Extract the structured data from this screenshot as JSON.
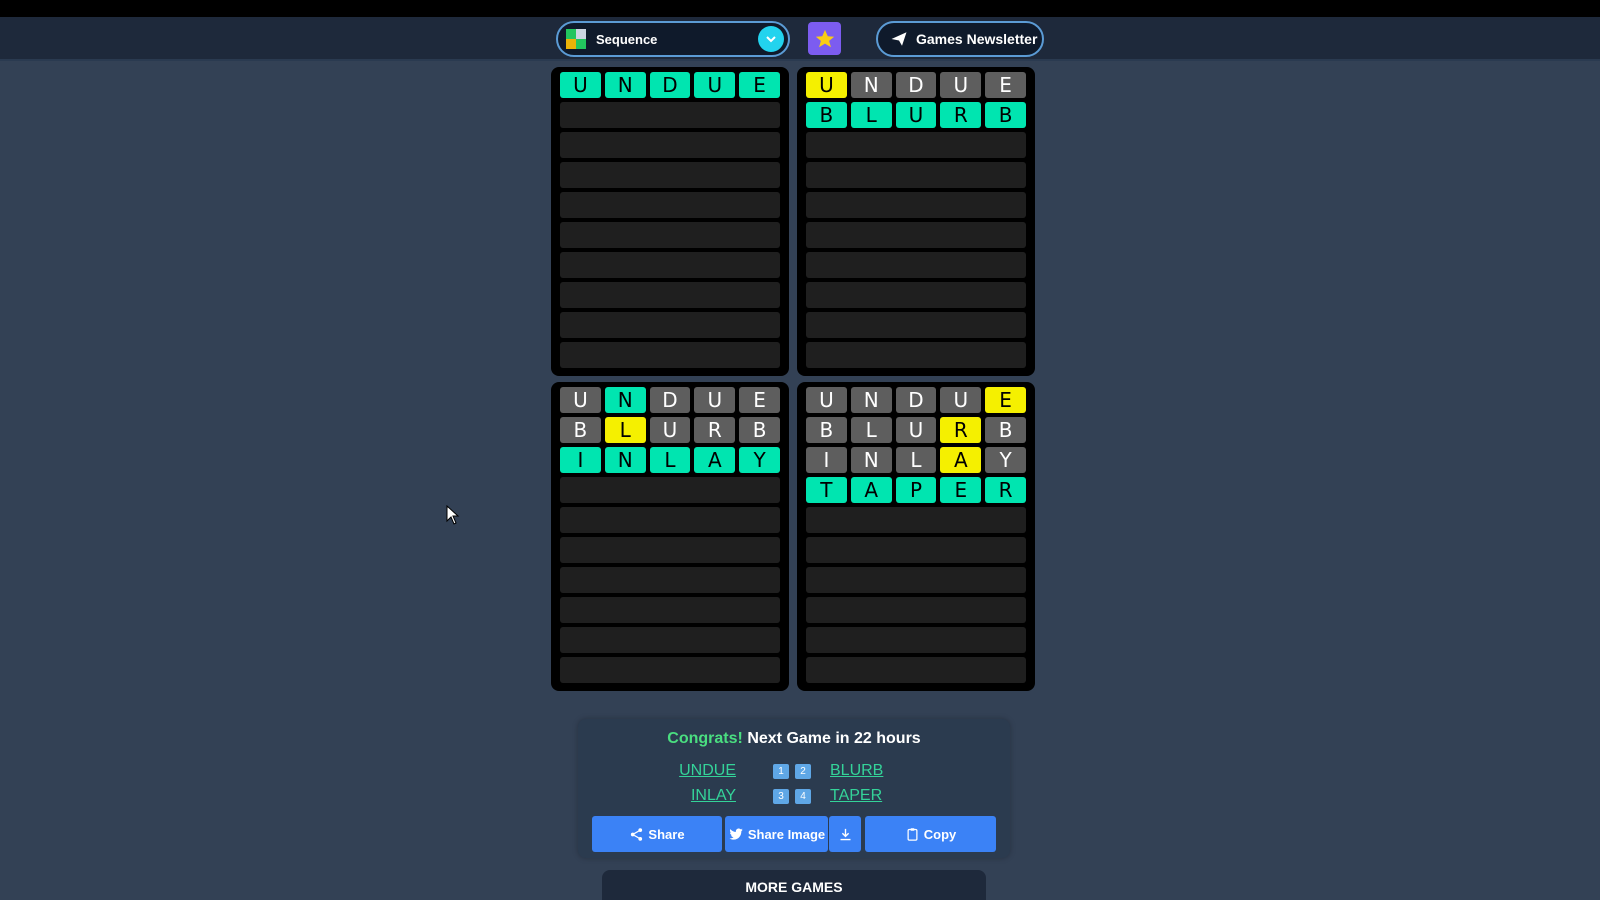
{
  "header": {
    "game_select_label": "Sequence",
    "newsletter_label": "Games Newsletter"
  },
  "boards": [
    {
      "rows": [
        [
          [
            "U",
            "g"
          ],
          [
            "N",
            "g"
          ],
          [
            "D",
            "g"
          ],
          [
            "U",
            "g"
          ],
          [
            "E",
            "g"
          ]
        ]
      ],
      "empty_rows": 9
    },
    {
      "rows": [
        [
          [
            "U",
            "y"
          ],
          [
            "N",
            "x"
          ],
          [
            "D",
            "x"
          ],
          [
            "U",
            "x"
          ],
          [
            "E",
            "x"
          ]
        ],
        [
          [
            "B",
            "g"
          ],
          [
            "L",
            "g"
          ],
          [
            "U",
            "g"
          ],
          [
            "R",
            "g"
          ],
          [
            "B",
            "g"
          ]
        ]
      ],
      "empty_rows": 8
    },
    {
      "rows": [
        [
          [
            "U",
            "x"
          ],
          [
            "N",
            "g"
          ],
          [
            "D",
            "x"
          ],
          [
            "U",
            "x"
          ],
          [
            "E",
            "x"
          ]
        ],
        [
          [
            "B",
            "x"
          ],
          [
            "L",
            "y"
          ],
          [
            "U",
            "x"
          ],
          [
            "R",
            "x"
          ],
          [
            "B",
            "x"
          ]
        ],
        [
          [
            "I",
            "g"
          ],
          [
            "N",
            "g"
          ],
          [
            "L",
            "g"
          ],
          [
            "A",
            "g"
          ],
          [
            "Y",
            "g"
          ]
        ]
      ],
      "empty_rows": 7
    },
    {
      "rows": [
        [
          [
            "U",
            "x"
          ],
          [
            "N",
            "x"
          ],
          [
            "D",
            "x"
          ],
          [
            "U",
            "x"
          ],
          [
            "E",
            "y"
          ]
        ],
        [
          [
            "B",
            "x"
          ],
          [
            "L",
            "x"
          ],
          [
            "U",
            "x"
          ],
          [
            "R",
            "y"
          ],
          [
            "B",
            "x"
          ]
        ],
        [
          [
            "I",
            "x"
          ],
          [
            "N",
            "x"
          ],
          [
            "L",
            "x"
          ],
          [
            "A",
            "y"
          ],
          [
            "Y",
            "x"
          ]
        ],
        [
          [
            "T",
            "g"
          ],
          [
            "A",
            "g"
          ],
          [
            "P",
            "g"
          ],
          [
            "E",
            "g"
          ],
          [
            "R",
            "g"
          ]
        ]
      ],
      "empty_rows": 6
    }
  ],
  "result": {
    "congrats": "Congrats!",
    "next_game": "Next Game in 22 hours",
    "answers": [
      "UNDUE",
      "BLURB",
      "INLAY",
      "TAPER"
    ],
    "badges": [
      "1",
      "2",
      "3",
      "4"
    ]
  },
  "buttons": {
    "share": "Share",
    "share_image": "Share Image",
    "copy": "Copy",
    "more_games": "MORE GAMES"
  },
  "colors": {
    "correct": "#00e5b0",
    "present": "#f5f000",
    "absent": "#5e5e5e"
  }
}
